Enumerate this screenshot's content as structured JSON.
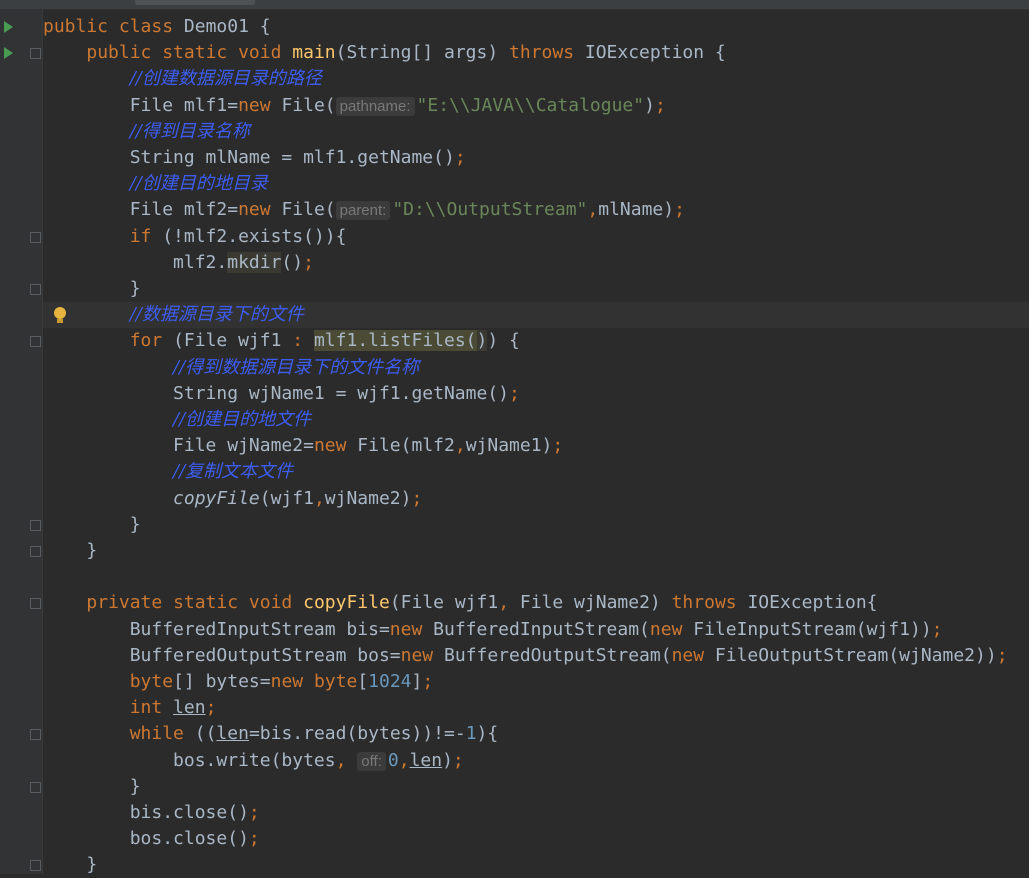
{
  "editor": {
    "lines": [
      [
        [
          "kw",
          "public "
        ],
        [
          "kw",
          "class "
        ],
        [
          "",
          "Demo01 {"
        ]
      ],
      [
        [
          "",
          "    "
        ],
        [
          "kw",
          "public "
        ],
        [
          "kw",
          "static "
        ],
        [
          "kw",
          "void "
        ],
        [
          "fn",
          "main"
        ],
        [
          "",
          "(String[] args) "
        ],
        [
          "kw",
          "throws "
        ],
        [
          "",
          "IOException {"
        ]
      ],
      [
        [
          "",
          "        "
        ],
        [
          "cm",
          "//创建数据源目录的路径"
        ]
      ],
      [
        [
          "",
          "        File mlf1="
        ],
        [
          "kw",
          "new "
        ],
        [
          "",
          "File("
        ],
        [
          "hint",
          "pathname:"
        ],
        [
          "str",
          "\"E:\\\\JAVA\\\\Catalogue\""
        ],
        [
          "",
          ")"
        ],
        [
          "semi",
          ";"
        ]
      ],
      [
        [
          "",
          "        "
        ],
        [
          "cm",
          "//得到目录名称"
        ]
      ],
      [
        [
          "",
          "        String mlName = mlf1.getName()"
        ],
        [
          "semi",
          ";"
        ]
      ],
      [
        [
          "",
          "        "
        ],
        [
          "cm",
          "//创建目的地目录"
        ]
      ],
      [
        [
          "",
          "        File mlf2="
        ],
        [
          "kw",
          "new "
        ],
        [
          "",
          "File("
        ],
        [
          "hint",
          "parent:"
        ],
        [
          "str",
          "\"D:\\\\OutputStream\""
        ],
        [
          "kw",
          ","
        ],
        [
          "",
          "mlName)"
        ],
        [
          "semi",
          ";"
        ]
      ],
      [
        [
          "",
          "        "
        ],
        [
          "kw",
          "if "
        ],
        [
          "",
          "(!mlf2.exists()){"
        ]
      ],
      [
        [
          "",
          "            mlf2."
        ],
        [
          "hl",
          "mkdir"
        ],
        [
          "",
          "()"
        ],
        [
          "semi",
          ";"
        ]
      ],
      [
        [
          "",
          "        }"
        ]
      ],
      [
        [
          "",
          "        "
        ],
        [
          "cm",
          "//数据源目录下的文件"
        ]
      ],
      [
        [
          "",
          "        "
        ],
        [
          "kw",
          "for "
        ],
        [
          "",
          "(File wjf1 "
        ],
        [
          "kw",
          ":"
        ],
        [
          "",
          " "
        ],
        [
          "hl2",
          "mlf1.listFiles("
        ],
        [
          "hl",
          ")"
        ],
        [
          "",
          ") {"
        ]
      ],
      [
        [
          "",
          "            "
        ],
        [
          "cm",
          "//得到数据源目录下的文件名称"
        ]
      ],
      [
        [
          "",
          "            String wjName1 = wjf1.getName()"
        ],
        [
          "semi",
          ";"
        ]
      ],
      [
        [
          "",
          "            "
        ],
        [
          "cm",
          "//创建目的地文件"
        ]
      ],
      [
        [
          "",
          "            File wjName2="
        ],
        [
          "kw",
          "new "
        ],
        [
          "",
          "File(mlf2"
        ],
        [
          "kw",
          ","
        ],
        [
          "",
          "wjName1)"
        ],
        [
          "semi",
          ";"
        ]
      ],
      [
        [
          "",
          "            "
        ],
        [
          "cm",
          "//复制文本文件"
        ]
      ],
      [
        [
          "",
          "            "
        ],
        [
          "it",
          "copyFile"
        ],
        [
          "",
          "(wjf1"
        ],
        [
          "kw",
          ","
        ],
        [
          "",
          "wjName2)"
        ],
        [
          "semi",
          ";"
        ]
      ],
      [
        [
          "",
          "        }"
        ]
      ],
      [
        [
          "",
          "    }"
        ]
      ],
      [
        [
          "",
          ""
        ]
      ],
      [
        [
          "",
          "    "
        ],
        [
          "kw",
          "private "
        ],
        [
          "kw",
          "static "
        ],
        [
          "kw",
          "void "
        ],
        [
          "fn",
          "copyFile"
        ],
        [
          "",
          "(File wjf1"
        ],
        [
          "kw",
          ", "
        ],
        [
          "",
          "File wjName2) "
        ],
        [
          "kw",
          "throws "
        ],
        [
          "",
          "IOException{"
        ]
      ],
      [
        [
          "",
          "        BufferedInputStream bis="
        ],
        [
          "kw",
          "new "
        ],
        [
          "",
          "BufferedInputStream("
        ],
        [
          "kw",
          "new "
        ],
        [
          "",
          "FileInputStream(wjf1))"
        ],
        [
          "semi",
          ";"
        ]
      ],
      [
        [
          "",
          "        BufferedOutputStream bos="
        ],
        [
          "kw",
          "new "
        ],
        [
          "",
          "BufferedOutputStream("
        ],
        [
          "kw",
          "new "
        ],
        [
          "",
          "FileOutputStream(wjName2))"
        ],
        [
          "semi",
          ";"
        ]
      ],
      [
        [
          "",
          "        "
        ],
        [
          "kw",
          "byte"
        ],
        [
          "",
          "[] bytes="
        ],
        [
          "kw",
          "new "
        ],
        [
          "kw",
          "byte"
        ],
        [
          "",
          "["
        ],
        [
          "num",
          "1024"
        ],
        [
          "",
          "]"
        ],
        [
          "semi",
          ";"
        ]
      ],
      [
        [
          "",
          "        "
        ],
        [
          "kw",
          "int "
        ],
        [
          "ul",
          "len"
        ],
        [
          "semi",
          ";"
        ]
      ],
      [
        [
          "",
          "        "
        ],
        [
          "kw",
          "while "
        ],
        [
          "",
          "(("
        ],
        [
          "ul",
          "len"
        ],
        [
          "",
          "=bis.read(bytes))!=-"
        ],
        [
          "num",
          "1"
        ],
        [
          "",
          "){"
        ]
      ],
      [
        [
          "",
          "            bos.write(bytes"
        ],
        [
          "kw",
          ", "
        ],
        [
          "hint",
          "off:"
        ],
        [
          "num",
          "0"
        ],
        [
          "kw",
          ","
        ],
        [
          "ul",
          "len"
        ],
        [
          "",
          ")"
        ],
        [
          "semi",
          ";"
        ]
      ],
      [
        [
          "",
          "        }"
        ]
      ],
      [
        [
          "",
          "        bis.close()"
        ],
        [
          "semi",
          ";"
        ]
      ],
      [
        [
          "",
          "        bos.close()"
        ],
        [
          "semi",
          ";"
        ]
      ],
      [
        [
          "",
          "    }"
        ]
      ]
    ],
    "current_line_index": 11
  },
  "gutter": {
    "run_icons_lines": [
      0,
      1
    ],
    "fold_lines": [
      1,
      8,
      10,
      12,
      19,
      20,
      22,
      27,
      29,
      32
    ],
    "bulb_line": 11,
    "icons": [
      "run-icon",
      "fold-icon",
      "intention-bulb-icon"
    ]
  },
  "colors": {
    "background": "#2b2b2b",
    "gutter": "#313335",
    "keyword": "#cc7832",
    "function": "#ffc66d",
    "string": "#6a8759",
    "number": "#6897bb",
    "comment": "#3d5df2",
    "text": "#a9b7c6"
  }
}
